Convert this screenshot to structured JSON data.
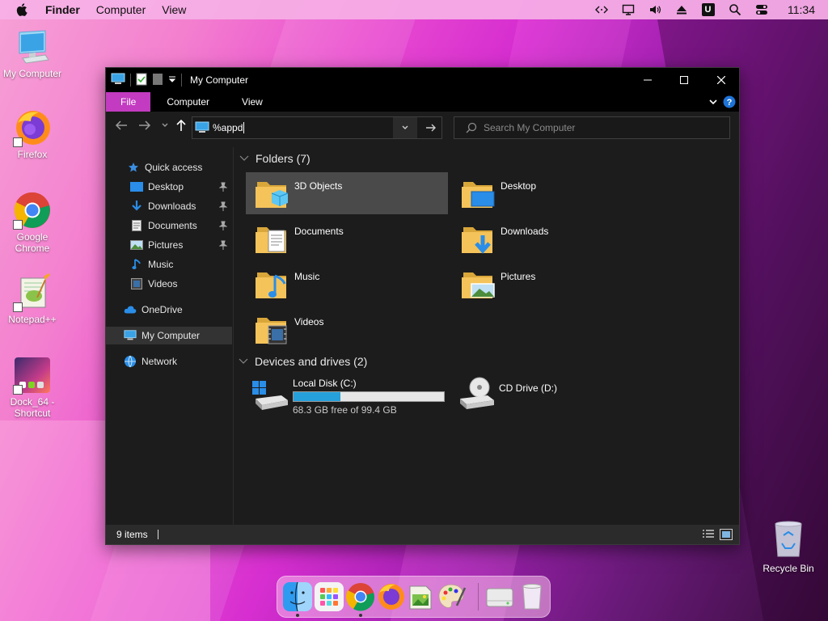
{
  "menubar": {
    "app_name": "Finder",
    "menus": [
      "Computer",
      "View"
    ],
    "status_icons": [
      "code-arrows-icon",
      "monitor-icon",
      "volume-icon",
      "eject-icon",
      "u-app-icon",
      "search-icon",
      "control-center-icon"
    ],
    "u_badge": "U",
    "clock": "11:34"
  },
  "desktop": {
    "icons": [
      {
        "label": "My Computer",
        "icon": "computer-icon"
      },
      {
        "label": "Firefox",
        "icon": "firefox-icon"
      },
      {
        "label": "Google Chrome",
        "icon": "chrome-icon"
      },
      {
        "label": "Notepad++",
        "icon": "notepadpp-icon"
      },
      {
        "label": "Dock_64 - Shortcut",
        "icon": "dock-shortcut-icon"
      }
    ],
    "recycle_bin": "Recycle Bin"
  },
  "window": {
    "title": "My Computer",
    "ribbon_tabs": [
      {
        "label": "File",
        "active": true
      },
      {
        "label": "Computer",
        "active": false
      },
      {
        "label": "View",
        "active": false
      }
    ],
    "address_value": "%appd",
    "search_placeholder": "Search My Computer",
    "sidebar": {
      "quick_access": "Quick access",
      "items": [
        {
          "label": "Desktop",
          "pinned": true
        },
        {
          "label": "Downloads",
          "pinned": true
        },
        {
          "label": "Documents",
          "pinned": true
        },
        {
          "label": "Pictures",
          "pinned": true
        },
        {
          "label": "Music",
          "pinned": false
        },
        {
          "label": "Videos",
          "pinned": false
        }
      ],
      "onedrive": "OneDrive",
      "my_computer": "My Computer",
      "network": "Network"
    },
    "folders_header": "Folders (7)",
    "folders": [
      "3D Objects",
      "Desktop",
      "Documents",
      "Downloads",
      "Music",
      "Pictures",
      "Videos"
    ],
    "devices_header": "Devices and drives (2)",
    "drives": [
      {
        "name": "Local Disk (C:)",
        "free_text": "68.3 GB free of 99.4 GB",
        "used_fraction": 0.313
      },
      {
        "name": "CD Drive (D:)"
      }
    ],
    "status": {
      "count": "9 items"
    }
  },
  "dock": {
    "items": [
      "finder-icon",
      "launchpad-icon",
      "chrome-icon",
      "firefox-icon",
      "image-viewer-icon",
      "paint-icon",
      "drive-icon",
      "trash-icon"
    ]
  },
  "colors": {
    "accent": "#c23bc0",
    "folder": "#f4c35a",
    "drive_bar": "#26a0da"
  }
}
